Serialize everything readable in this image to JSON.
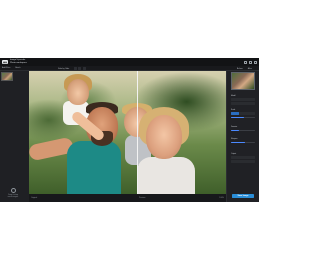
{
  "app": {
    "title": "Image Upscaler",
    "subtitle": "Photo workspace",
    "logo_text": "▮▮▮"
  },
  "toolbar": {
    "left_items": [
      "Add Files",
      "Batch"
    ],
    "center_label": "Side by Side",
    "right_items": [
      "Before",
      "After"
    ]
  },
  "left_panel": {
    "info_text_1": "Drag & drop",
    "info_text_2": "more images"
  },
  "status": {
    "left": "Original",
    "center": "Preview",
    "right": "100%"
  },
  "right_panel": {
    "section_1": "Model",
    "section_2": "Scale",
    "section_3": "Denoise",
    "section_4": "Sharpen",
    "section_5": "Output",
    "apply_label": "Save Image"
  },
  "controls": {
    "scale_fraction": 0.55,
    "denoise_fraction": 0.35,
    "sharpen_fraction": 0.6
  },
  "colors": {
    "accent": "#2a8ed8",
    "panel_bg": "#202125"
  }
}
